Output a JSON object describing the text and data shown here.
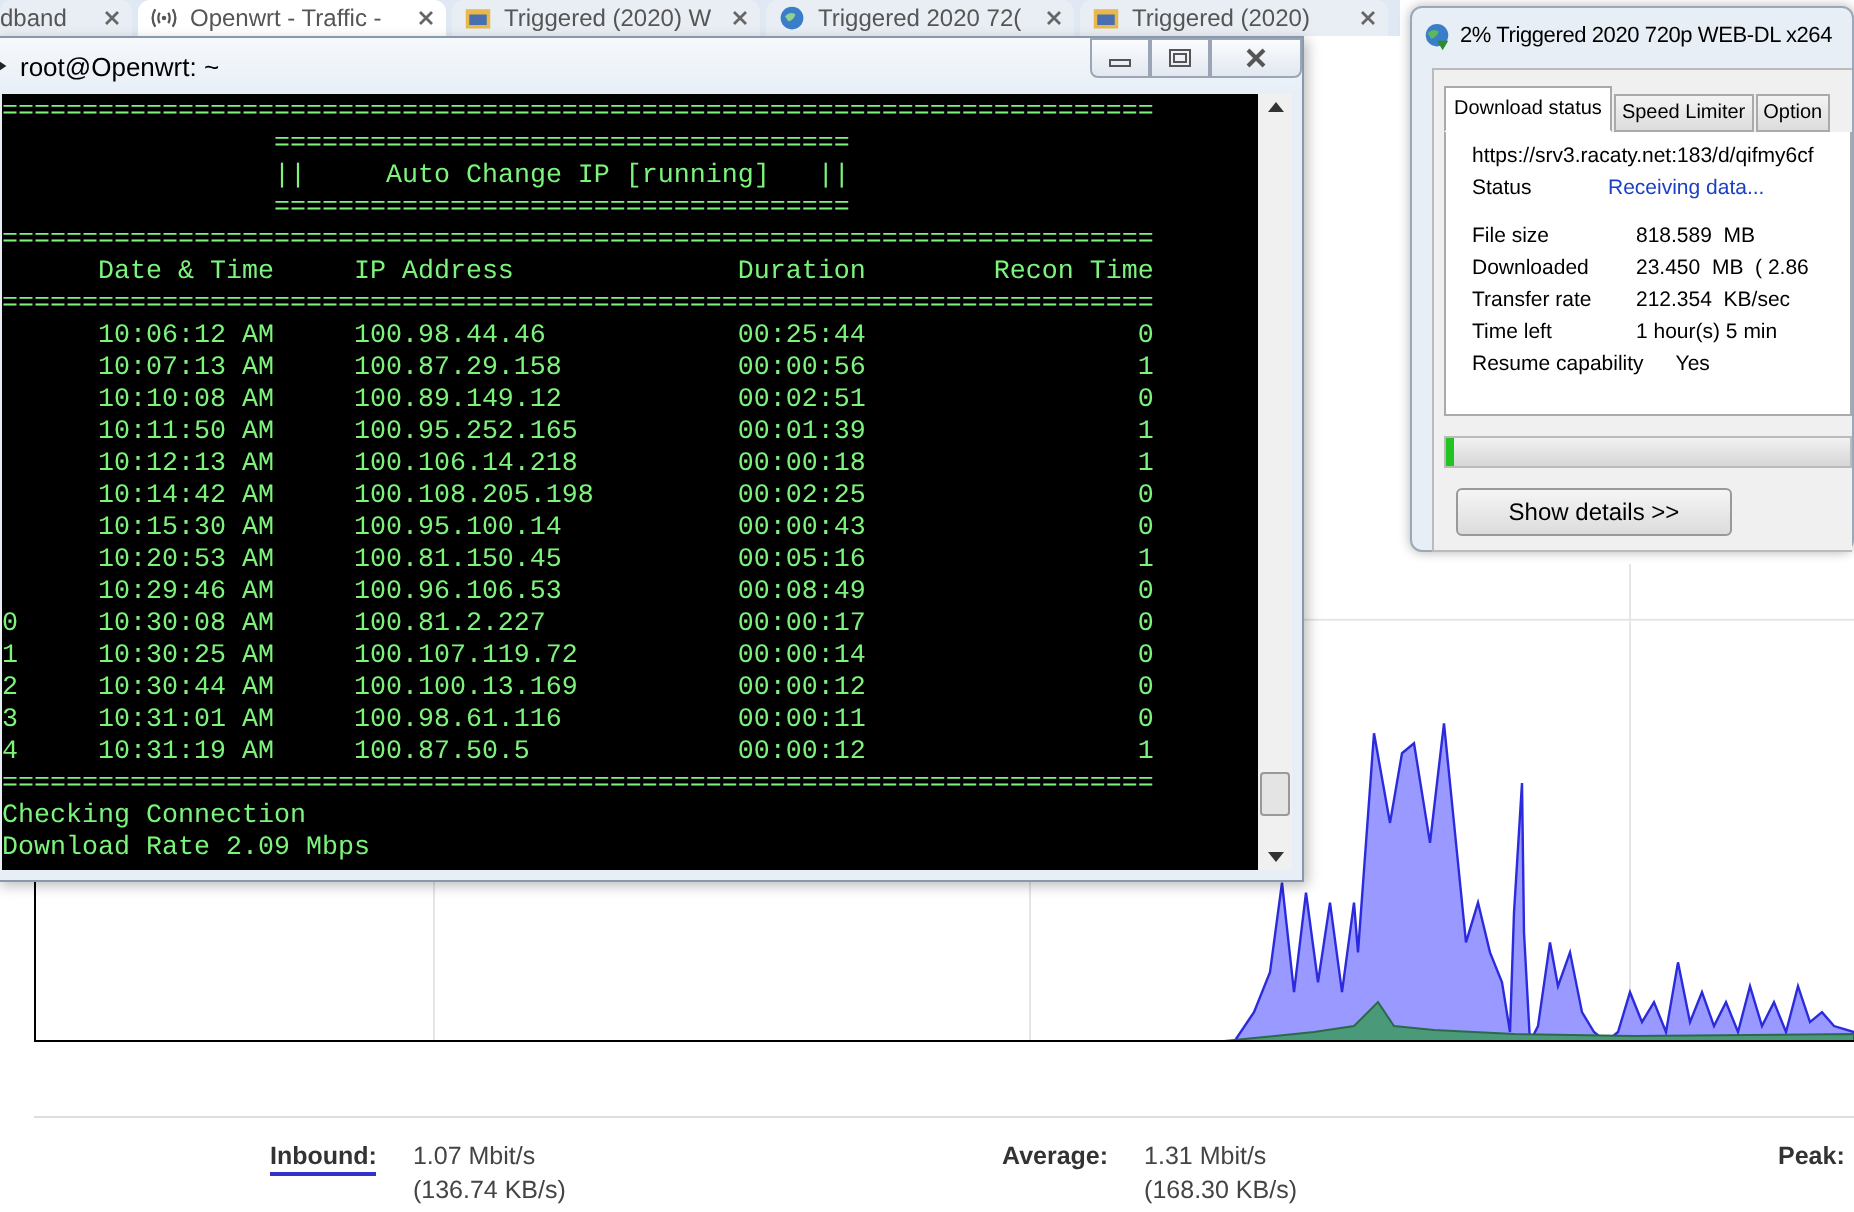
{
  "browser_tabs": [
    {
      "label": "dband",
      "selected": false
    },
    {
      "label": "Openwrt - Traffic -",
      "selected": true
    },
    {
      "label": "Triggered (2020) W",
      "selected": false
    },
    {
      "label": "Triggered 2020 72(",
      "selected": false
    },
    {
      "label": "Triggered (2020)",
      "selected": false
    }
  ],
  "terminal": {
    "title": "root@Openwrt: ~",
    "lines": [
      {
        "kind": "rule",
        "text": "========================================================================"
      },
      {
        "kind": "banner",
        "text": "===================================="
      },
      {
        "kind": "banner",
        "text": "||     Auto Change IP [running]   ||"
      },
      {
        "kind": "banner",
        "text": "===================================="
      },
      {
        "kind": "rule",
        "text": "========================================================================"
      },
      {
        "kind": "header",
        "columns": [
          "Date & Time",
          "IP Address",
          "Duration",
          "Recon Time"
        ]
      },
      {
        "kind": "rule",
        "text": "========================================================================"
      },
      {
        "kind": "row",
        "cells": [
          "10:06:12 AM",
          "100.98.44.46",
          "00:25:44",
          "0"
        ]
      },
      {
        "kind": "row",
        "cells": [
          "10:07:13 AM",
          "100.87.29.158",
          "00:00:56",
          "1"
        ]
      },
      {
        "kind": "row",
        "cells": [
          "10:10:08 AM",
          "100.89.149.12",
          "00:02:51",
          "0"
        ]
      },
      {
        "kind": "row",
        "cells": [
          "10:11:50 AM",
          "100.95.252.165",
          "00:01:39",
          "1"
        ]
      },
      {
        "kind": "row",
        "cells": [
          "10:12:13 AM",
          "100.106.14.218",
          "00:00:18",
          "1"
        ]
      },
      {
        "kind": "row",
        "cells": [
          "10:14:42 AM",
          "100.108.205.198",
          "00:02:25",
          "0"
        ]
      },
      {
        "kind": "row",
        "cells": [
          "10:15:30 AM",
          "100.95.100.14",
          "00:00:43",
          "0"
        ]
      },
      {
        "kind": "row",
        "cells": [
          "10:20:53 AM",
          "100.81.150.45",
          "00:05:16",
          "1"
        ]
      },
      {
        "kind": "row",
        "cells": [
          "10:29:46 AM",
          "100.96.106.53",
          "00:08:49",
          "0"
        ]
      },
      {
        "kind": "row",
        "index": "0",
        "cells": [
          "10:30:08 AM",
          "100.81.2.227",
          "00:00:17",
          "0"
        ]
      },
      {
        "kind": "row",
        "index": "1",
        "cells": [
          "10:30:25 AM",
          "100.107.119.72",
          "00:00:14",
          "0"
        ]
      },
      {
        "kind": "row",
        "index": "2",
        "cells": [
          "10:30:44 AM",
          "100.100.13.169",
          "00:00:12",
          "0"
        ]
      },
      {
        "kind": "row",
        "index": "3",
        "cells": [
          "10:31:01 AM",
          "100.98.61.116",
          "00:00:11",
          "0"
        ]
      },
      {
        "kind": "row",
        "index": "4",
        "cells": [
          "10:31:19 AM",
          "100.87.50.5",
          "00:00:12",
          "1"
        ]
      },
      {
        "kind": "rule",
        "text": "========================================================================"
      },
      {
        "kind": "text",
        "text": "Checking Connection"
      },
      {
        "kind": "text",
        "text": "Download Rate 2.09 Mbps"
      }
    ]
  },
  "download_dialog": {
    "title": "2% Triggered 2020 720p WEB-DL x264",
    "tabs": [
      {
        "label": "Download status",
        "selected": true
      },
      {
        "label": "Speed Limiter",
        "selected": false
      },
      {
        "label": "Option",
        "selected": false
      }
    ],
    "url": "https://srv3.racaty.net:183/d/qifmy6cf",
    "status": {
      "label": "Status",
      "value": "Receiving data..."
    },
    "fields": [
      {
        "label": "File size",
        "value": "818.589  MB"
      },
      {
        "label": "Downloaded",
        "value": "23.450  MB  ( 2.86"
      },
      {
        "label": "Transfer rate",
        "value": "212.354  KB/sec"
      },
      {
        "label": "Time left",
        "value": "1 hour(s) 5 min"
      },
      {
        "label": "Resume capability",
        "value": "Yes"
      }
    ],
    "progress": {
      "level": 0.02
    },
    "details_button": "Show details >>"
  },
  "traffic_stats": [
    {
      "label": "Inbound:",
      "values": [
        "1.07 Mbit/s",
        "(136.74 KB/s)"
      ],
      "selected": true
    },
    {
      "label": "Average:",
      "values": [
        "1.31 Mbit/s",
        "(168.30 KB/s)"
      ],
      "selected": false
    },
    {
      "label": "Peak:",
      "selected": false
    }
  ]
}
